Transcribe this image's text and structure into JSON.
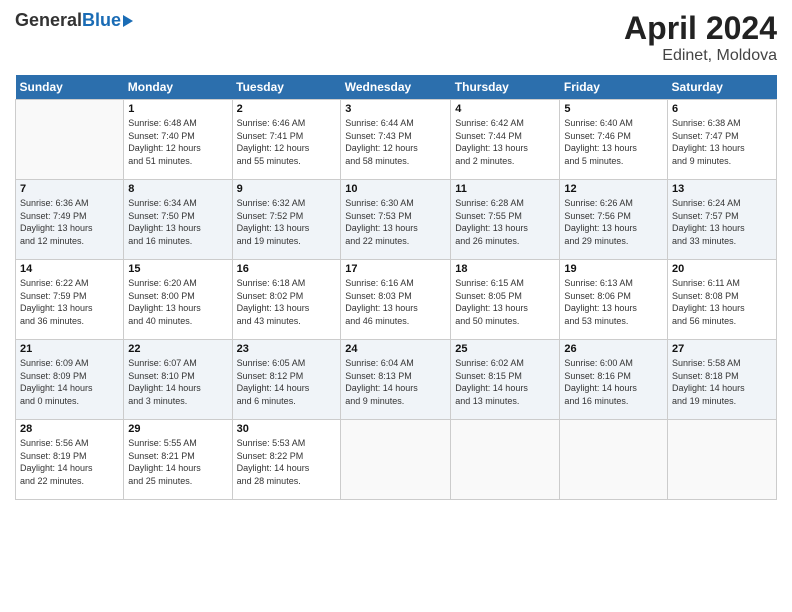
{
  "header": {
    "logo_general": "General",
    "logo_blue": "Blue",
    "title_month": "April 2024",
    "title_location": "Edinet, Moldova"
  },
  "days_of_week": [
    "Sunday",
    "Monday",
    "Tuesday",
    "Wednesday",
    "Thursday",
    "Friday",
    "Saturday"
  ],
  "weeks": [
    [
      {
        "num": "",
        "detail": ""
      },
      {
        "num": "1",
        "detail": "Sunrise: 6:48 AM\nSunset: 7:40 PM\nDaylight: 12 hours\nand 51 minutes."
      },
      {
        "num": "2",
        "detail": "Sunrise: 6:46 AM\nSunset: 7:41 PM\nDaylight: 12 hours\nand 55 minutes."
      },
      {
        "num": "3",
        "detail": "Sunrise: 6:44 AM\nSunset: 7:43 PM\nDaylight: 12 hours\nand 58 minutes."
      },
      {
        "num": "4",
        "detail": "Sunrise: 6:42 AM\nSunset: 7:44 PM\nDaylight: 13 hours\nand 2 minutes."
      },
      {
        "num": "5",
        "detail": "Sunrise: 6:40 AM\nSunset: 7:46 PM\nDaylight: 13 hours\nand 5 minutes."
      },
      {
        "num": "6",
        "detail": "Sunrise: 6:38 AM\nSunset: 7:47 PM\nDaylight: 13 hours\nand 9 minutes."
      }
    ],
    [
      {
        "num": "7",
        "detail": "Sunrise: 6:36 AM\nSunset: 7:49 PM\nDaylight: 13 hours\nand 12 minutes."
      },
      {
        "num": "8",
        "detail": "Sunrise: 6:34 AM\nSunset: 7:50 PM\nDaylight: 13 hours\nand 16 minutes."
      },
      {
        "num": "9",
        "detail": "Sunrise: 6:32 AM\nSunset: 7:52 PM\nDaylight: 13 hours\nand 19 minutes."
      },
      {
        "num": "10",
        "detail": "Sunrise: 6:30 AM\nSunset: 7:53 PM\nDaylight: 13 hours\nand 22 minutes."
      },
      {
        "num": "11",
        "detail": "Sunrise: 6:28 AM\nSunset: 7:55 PM\nDaylight: 13 hours\nand 26 minutes."
      },
      {
        "num": "12",
        "detail": "Sunrise: 6:26 AM\nSunset: 7:56 PM\nDaylight: 13 hours\nand 29 minutes."
      },
      {
        "num": "13",
        "detail": "Sunrise: 6:24 AM\nSunset: 7:57 PM\nDaylight: 13 hours\nand 33 minutes."
      }
    ],
    [
      {
        "num": "14",
        "detail": "Sunrise: 6:22 AM\nSunset: 7:59 PM\nDaylight: 13 hours\nand 36 minutes."
      },
      {
        "num": "15",
        "detail": "Sunrise: 6:20 AM\nSunset: 8:00 PM\nDaylight: 13 hours\nand 40 minutes."
      },
      {
        "num": "16",
        "detail": "Sunrise: 6:18 AM\nSunset: 8:02 PM\nDaylight: 13 hours\nand 43 minutes."
      },
      {
        "num": "17",
        "detail": "Sunrise: 6:16 AM\nSunset: 8:03 PM\nDaylight: 13 hours\nand 46 minutes."
      },
      {
        "num": "18",
        "detail": "Sunrise: 6:15 AM\nSunset: 8:05 PM\nDaylight: 13 hours\nand 50 minutes."
      },
      {
        "num": "19",
        "detail": "Sunrise: 6:13 AM\nSunset: 8:06 PM\nDaylight: 13 hours\nand 53 minutes."
      },
      {
        "num": "20",
        "detail": "Sunrise: 6:11 AM\nSunset: 8:08 PM\nDaylight: 13 hours\nand 56 minutes."
      }
    ],
    [
      {
        "num": "21",
        "detail": "Sunrise: 6:09 AM\nSunset: 8:09 PM\nDaylight: 14 hours\nand 0 minutes."
      },
      {
        "num": "22",
        "detail": "Sunrise: 6:07 AM\nSunset: 8:10 PM\nDaylight: 14 hours\nand 3 minutes."
      },
      {
        "num": "23",
        "detail": "Sunrise: 6:05 AM\nSunset: 8:12 PM\nDaylight: 14 hours\nand 6 minutes."
      },
      {
        "num": "24",
        "detail": "Sunrise: 6:04 AM\nSunset: 8:13 PM\nDaylight: 14 hours\nand 9 minutes."
      },
      {
        "num": "25",
        "detail": "Sunrise: 6:02 AM\nSunset: 8:15 PM\nDaylight: 14 hours\nand 13 minutes."
      },
      {
        "num": "26",
        "detail": "Sunrise: 6:00 AM\nSunset: 8:16 PM\nDaylight: 14 hours\nand 16 minutes."
      },
      {
        "num": "27",
        "detail": "Sunrise: 5:58 AM\nSunset: 8:18 PM\nDaylight: 14 hours\nand 19 minutes."
      }
    ],
    [
      {
        "num": "28",
        "detail": "Sunrise: 5:56 AM\nSunset: 8:19 PM\nDaylight: 14 hours\nand 22 minutes."
      },
      {
        "num": "29",
        "detail": "Sunrise: 5:55 AM\nSunset: 8:21 PM\nDaylight: 14 hours\nand 25 minutes."
      },
      {
        "num": "30",
        "detail": "Sunrise: 5:53 AM\nSunset: 8:22 PM\nDaylight: 14 hours\nand 28 minutes."
      },
      {
        "num": "",
        "detail": ""
      },
      {
        "num": "",
        "detail": ""
      },
      {
        "num": "",
        "detail": ""
      },
      {
        "num": "",
        "detail": ""
      }
    ]
  ]
}
